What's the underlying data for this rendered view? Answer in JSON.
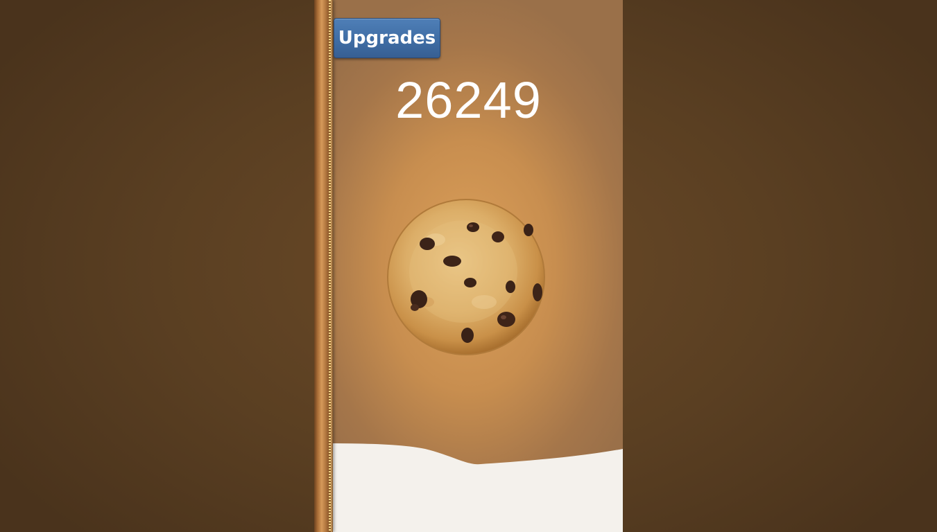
{
  "upgrades_button": {
    "label": "Upgrades"
  },
  "cookie_count": "26249",
  "cookie": {
    "icon": "cookie-icon"
  },
  "colors": {
    "button_blue": "#3e6ca3",
    "panel_center": "#dca05a",
    "panel_edge": "#9a7049",
    "milk": "#f4f1ec",
    "backdrop": "#5a3f22"
  }
}
